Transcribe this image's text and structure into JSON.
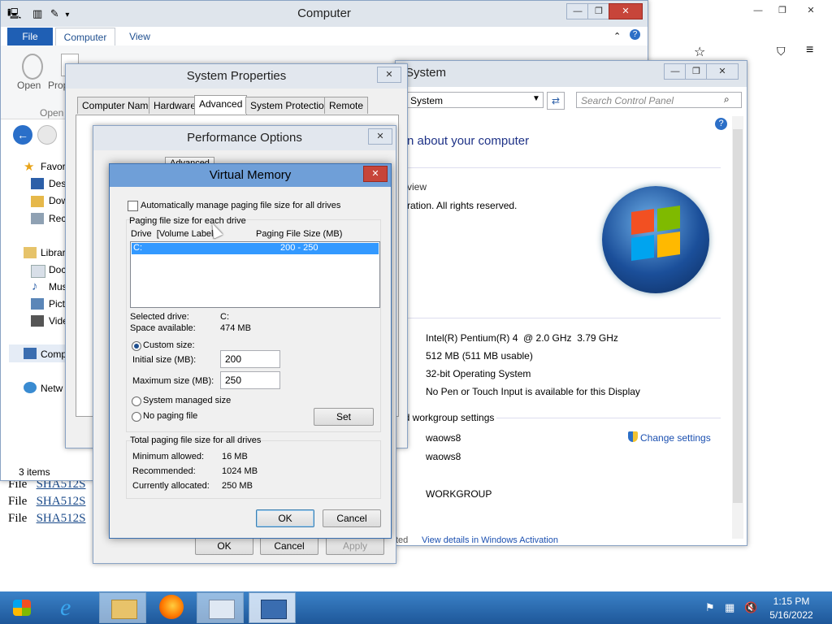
{
  "explorer": {
    "title": "Computer",
    "ribbon_tabs": [
      "File",
      "Computer",
      "View"
    ],
    "ribbon_buttons": [
      "Open",
      "Prop"
    ],
    "group_label": "Open",
    "nav": [
      {
        "label": "Favori",
        "icon": "star-icon"
      },
      {
        "label": "Desk",
        "icon": "desktop-icon"
      },
      {
        "label": "Dow",
        "icon": "downloads-icon"
      },
      {
        "label": "Rece",
        "icon": "recent-places-icon"
      },
      {
        "label": "Librar",
        "icon": "libraries-icon"
      },
      {
        "label": "Doc",
        "icon": "documents-icon"
      },
      {
        "label": "Mus",
        "icon": "music-icon"
      },
      {
        "label": "Pict",
        "icon": "pictures-icon"
      },
      {
        "label": "Vide",
        "icon": "videos-icon"
      },
      {
        "label": "Comp",
        "icon": "computer-icon"
      },
      {
        "label": "Netw",
        "icon": "network-icon"
      }
    ],
    "status": "3 items"
  },
  "background_page": {
    "rows": [
      {
        "label": "File",
        "link": "SHA512S"
      },
      {
        "label": "File",
        "link": "SHA512S"
      },
      {
        "label": "File",
        "link": "SHA512S"
      }
    ]
  },
  "system_window": {
    "title": "System",
    "address": "System",
    "search_placeholder": "Search Control Panel",
    "heading": "n about your computer",
    "edition_frag": "view",
    "copyright_frag": "ration. All rights reserved.",
    "processor": "Intel(R) Pentium(R) 4  @ 2.0 GHz  3.79 GHz",
    "ram": "512 MB (511 MB usable)",
    "system_type": "32-bit Operating System",
    "pen_touch": "No Pen or Touch Input is available for this Display",
    "workgroup_heading": "nd workgroup settings",
    "computer_name": "waows8",
    "full_name": "waows8",
    "workgroup": "WORKGROUP",
    "change_settings": "Change settings",
    "activation_frag": "ted",
    "activation_link": "View details in Windows Activation"
  },
  "system_properties": {
    "title": "System Properties",
    "tabs": [
      "Computer Name",
      "Hardware",
      "Advanced",
      "System Protection",
      "Remote"
    ],
    "buttons": {
      "ok": "OK",
      "cancel": "Cancel",
      "apply": "Apply"
    }
  },
  "performance_options": {
    "title": "Performance Options",
    "tabs": [
      "Advanced"
    ]
  },
  "virtual_memory": {
    "title": "Virtual Memory",
    "auto_manage_label": "Automatically manage paging file size for all drives",
    "auto_manage_checked": false,
    "group_label": "Paging file size for each drive",
    "col_drive": "Drive  [Volume Label]",
    "col_size": "Paging File Size (MB)",
    "rows": [
      {
        "drive": "C:",
        "size": "200 - 250"
      }
    ],
    "selected_drive_label": "Selected drive:",
    "selected_drive_value": "C:",
    "space_label": "Space available:",
    "space_value": "474 MB",
    "custom_label": "Custom size:",
    "initial_label": "Initial size (MB):",
    "initial_value": "200",
    "max_label": "Maximum size (MB):",
    "max_value": "250",
    "system_managed_label": "System managed size",
    "no_paging_label": "No paging file",
    "set_label": "Set",
    "total_group_label": "Total paging file size for all drives",
    "min_label": "Minimum allowed:",
    "min_value": "16 MB",
    "rec_label": "Recommended:",
    "rec_value": "1024 MB",
    "cur_label": "Currently allocated:",
    "cur_value": "250 MB",
    "ok_label": "OK",
    "cancel_label": "Cancel"
  },
  "taskbar": {
    "time": "1:15 PM",
    "date": "5/16/2022",
    "apps": [
      "start-icon",
      "internet-explorer-icon",
      "file-explorer-icon",
      "firefox-icon",
      "control-panel-icon",
      "system-properties-icon"
    ]
  },
  "colors": {
    "accent": "#6f9fd8",
    "selection": "#3399ff",
    "taskbar": "#1e5799"
  }
}
